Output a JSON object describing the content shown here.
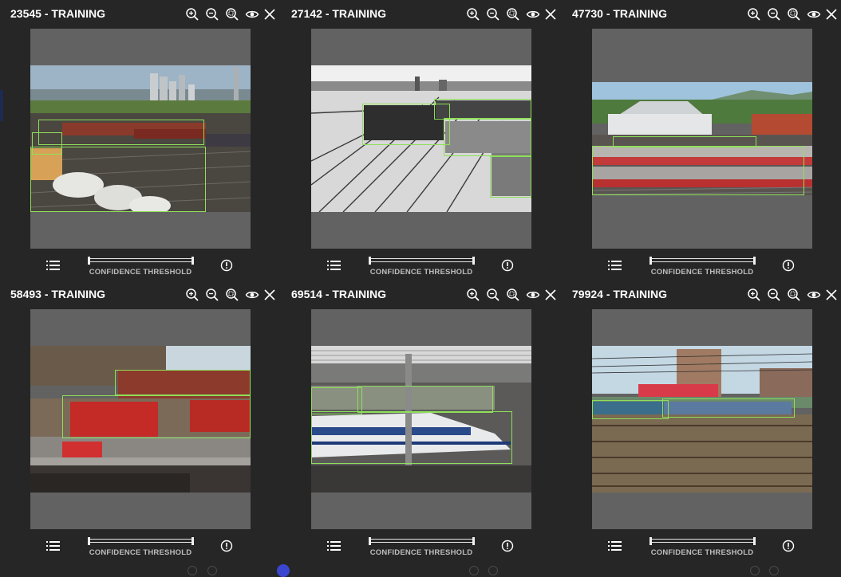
{
  "colors": {
    "background": "#262626",
    "canvas": "#626262",
    "bbox": "#8ee05a",
    "text": "#ffffff",
    "label": "#bdbdbd",
    "accent_dot": "#3b46d0"
  },
  "icons": [
    "zoom-in-icon",
    "zoom-out-icon",
    "zoom-fit-icon",
    "eye-icon",
    "close-icon",
    "list-icon",
    "alert-icon"
  ],
  "cards": [
    {
      "title": "23545 - TRAINING",
      "slider_label": "CONFIDENCE THRESHOLD",
      "photo": "freight train yard with silos"
    },
    {
      "title": "27142 - TRAINING",
      "slider_label": "CONFIDENCE THRESHOLD",
      "photo": "black and white snowy rail yard"
    },
    {
      "title": "47730 - TRAINING",
      "slider_label": "CONFIDENCE THRESHOLD",
      "photo": "red passenger trains at depot"
    },
    {
      "title": "58493 - TRAINING",
      "slider_label": "CONFIDENCE THRESHOLD",
      "photo": "model railroad red caboose"
    },
    {
      "title": "69514 - TRAINING",
      "slider_label": "CONFIDENCE THRESHOLD",
      "photo": "white bullet train in station"
    },
    {
      "title": "79924 - TRAINING",
      "slider_label": "CONFIDENCE THRESHOLD",
      "photo": "locomotive behind blurred tracks"
    }
  ]
}
